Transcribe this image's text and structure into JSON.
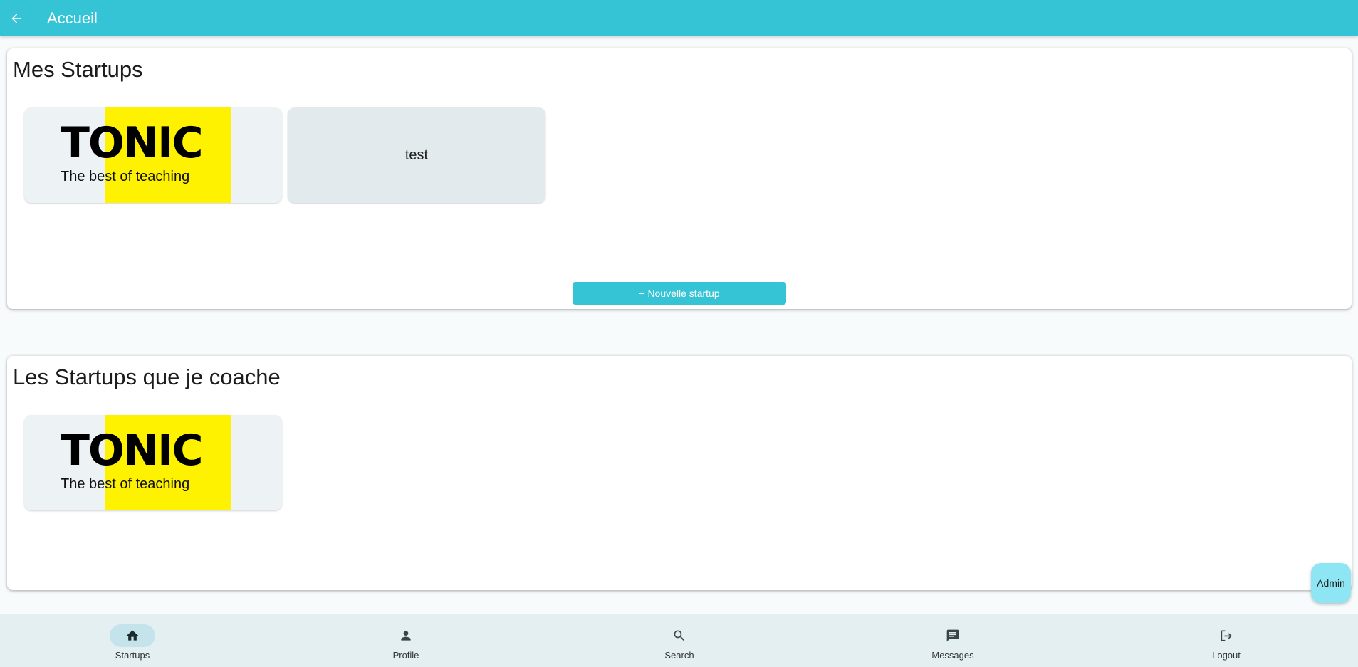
{
  "appbar": {
    "title": "Accueil",
    "back_icon": "arrow-left-icon"
  },
  "my_startups": {
    "title": "Mes Startups",
    "tiles": [
      {
        "type": "logo",
        "brand": "TONIC",
        "tagline": "The best of teaching"
      },
      {
        "type": "text",
        "label": "test"
      }
    ],
    "new_button_label": "+ Nouvelle startup"
  },
  "coached_startups": {
    "title": "Les Startups que je coache",
    "tiles": [
      {
        "type": "logo",
        "brand": "TONIC",
        "tagline": "The best of teaching"
      }
    ]
  },
  "admin_button": {
    "label": "Admin"
  },
  "bottom_nav": {
    "items": [
      {
        "label": "Startups",
        "icon": "home-icon",
        "active": true
      },
      {
        "label": "Profile",
        "icon": "person-icon",
        "active": false
      },
      {
        "label": "Search",
        "icon": "search-icon",
        "active": false
      },
      {
        "label": "Messages",
        "icon": "message-icon",
        "active": false
      },
      {
        "label": "Logout",
        "icon": "logout-icon",
        "active": false
      }
    ]
  },
  "colors": {
    "primary": "#35c3d6",
    "logo_yellow": "#fff200",
    "admin_fab": "#8ee6f5",
    "nav_bg": "#e3eff1"
  }
}
